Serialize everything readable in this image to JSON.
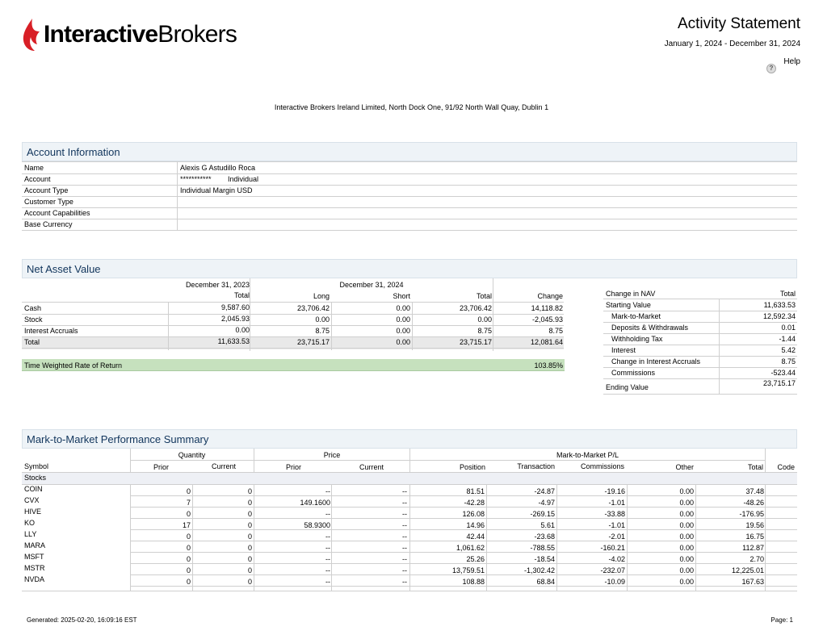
{
  "logo": {
    "part1": "Interactive",
    "part2": "Brokers",
    "color": "#d81f26"
  },
  "header": {
    "title": "Activity Statement",
    "period": "January 1, 2024 - December 31, 2024",
    "help": "Help",
    "help_icon": "question-icon"
  },
  "entity": "Interactive Brokers Ireland Limited, North Dock One, 91/92 North Wall Quay, Dublin 1",
  "account_info": {
    "title": "Account Information",
    "rows": [
      {
        "label": "Name",
        "value": "Alexis G Astudillo Roca",
        "extra": ""
      },
      {
        "label": "Account",
        "value": "***********",
        "extra": "Individual"
      },
      {
        "label": "Account Type",
        "value": "Individual Margin USD",
        "extra": ""
      },
      {
        "label": "Customer Type",
        "value": "",
        "extra": ""
      },
      {
        "label": "Account Capabilities",
        "value": "",
        "extra": ""
      },
      {
        "label": "Base Currency",
        "value": "",
        "extra": ""
      }
    ]
  },
  "nav": {
    "title": "Net Asset Value",
    "date_prev": "December 31, 2023",
    "date_cur": "December 31, 2024",
    "columns": [
      "Total",
      "Long",
      "Short",
      "Total",
      "Change"
    ],
    "rows": [
      {
        "label": "Cash",
        "prev_total": "9,587.60",
        "long": "23,706.42",
        "short": "0.00",
        "total": "23,706.42",
        "change": "14,118.82"
      },
      {
        "label": "Stock",
        "prev_total": "2,045.93",
        "long": "0.00",
        "short": "0.00",
        "total": "0.00",
        "change": "-2,045.93"
      },
      {
        "label": "Interest Accruals",
        "prev_total": "0.00",
        "long": "8.75",
        "short": "0.00",
        "total": "8.75",
        "change": "8.75"
      },
      {
        "label": "Total",
        "prev_total": "11,633.53",
        "long": "23,715.17",
        "short": "0.00",
        "total": "23,715.17",
        "change": "12,081.64"
      }
    ],
    "twr_label": "Time Weighted Rate of Return",
    "twr_value": "103.85%",
    "change_header": "Change in NAV",
    "change_total_header": "Total",
    "change_rows": [
      {
        "label": "Starting Value",
        "value": "11,633.53"
      },
      {
        "label": "Mark-to-Market",
        "value": "12,592.34"
      },
      {
        "label": "Deposits & Withdrawals",
        "value": "0.01"
      },
      {
        "label": "Withholding Tax",
        "value": "-1.44"
      },
      {
        "label": "Interest",
        "value": "5.42"
      },
      {
        "label": "Change in Interest Accruals",
        "value": "8.75"
      },
      {
        "label": "Commissions",
        "value": "-523.44"
      },
      {
        "label": "Ending Value",
        "value": "23,715.17"
      }
    ]
  },
  "mtm": {
    "title": "Mark-to-Market Performance Summary",
    "group_quantity": "Quantity",
    "group_price": "Price",
    "group_pl": "Mark-to-Market P/L",
    "headers": {
      "symbol": "Symbol",
      "q_prior": "Prior",
      "q_current": "Current",
      "p_prior": "Prior",
      "p_current": "Current",
      "position": "Position",
      "transaction": "Transaction",
      "commissions": "Commissions",
      "other": "Other",
      "total": "Total",
      "code": "Code"
    },
    "category": "Stocks",
    "rows": [
      {
        "symbol": "COIN",
        "q_prior": "0",
        "q_current": "0",
        "p_prior": "--",
        "p_current": "--",
        "position": "81.51",
        "transaction": "-24.87",
        "commissions": "-19.16",
        "other": "0.00",
        "total": "37.48",
        "code": ""
      },
      {
        "symbol": "CVX",
        "q_prior": "7",
        "q_current": "0",
        "p_prior": "149.1600",
        "p_current": "--",
        "position": "-42.28",
        "transaction": "-4.97",
        "commissions": "-1.01",
        "other": "0.00",
        "total": "-48.26",
        "code": ""
      },
      {
        "symbol": "HIVE",
        "q_prior": "0",
        "q_current": "0",
        "p_prior": "--",
        "p_current": "--",
        "position": "126.08",
        "transaction": "-269.15",
        "commissions": "-33.88",
        "other": "0.00",
        "total": "-176.95",
        "code": ""
      },
      {
        "symbol": "KO",
        "q_prior": "17",
        "q_current": "0",
        "p_prior": "58.9300",
        "p_current": "--",
        "position": "14.96",
        "transaction": "5.61",
        "commissions": "-1.01",
        "other": "0.00",
        "total": "19.56",
        "code": ""
      },
      {
        "symbol": "LLY",
        "q_prior": "0",
        "q_current": "0",
        "p_prior": "--",
        "p_current": "--",
        "position": "42.44",
        "transaction": "-23.68",
        "commissions": "-2.01",
        "other": "0.00",
        "total": "16.75",
        "code": ""
      },
      {
        "symbol": "MARA",
        "q_prior": "0",
        "q_current": "0",
        "p_prior": "--",
        "p_current": "--",
        "position": "1,061.62",
        "transaction": "-788.55",
        "commissions": "-160.21",
        "other": "0.00",
        "total": "112.87",
        "code": ""
      },
      {
        "symbol": "MSFT",
        "q_prior": "0",
        "q_current": "0",
        "p_prior": "--",
        "p_current": "--",
        "position": "25.26",
        "transaction": "-18.54",
        "commissions": "-4.02",
        "other": "0.00",
        "total": "2.70",
        "code": ""
      },
      {
        "symbol": "MSTR",
        "q_prior": "0",
        "q_current": "0",
        "p_prior": "--",
        "p_current": "--",
        "position": "13,759.51",
        "transaction": "-1,302.42",
        "commissions": "-232.07",
        "other": "0.00",
        "total": "12,225.01",
        "code": ""
      },
      {
        "symbol": "NVDA",
        "q_prior": "0",
        "q_current": "0",
        "p_prior": "--",
        "p_current": "--",
        "position": "108.88",
        "transaction": "68.84",
        "commissions": "-10.09",
        "other": "0.00",
        "total": "167.63",
        "code": ""
      }
    ]
  },
  "footer": {
    "generated": "Generated: 2025-02-20, 16:09:16 EST",
    "page": "Page: 1"
  }
}
